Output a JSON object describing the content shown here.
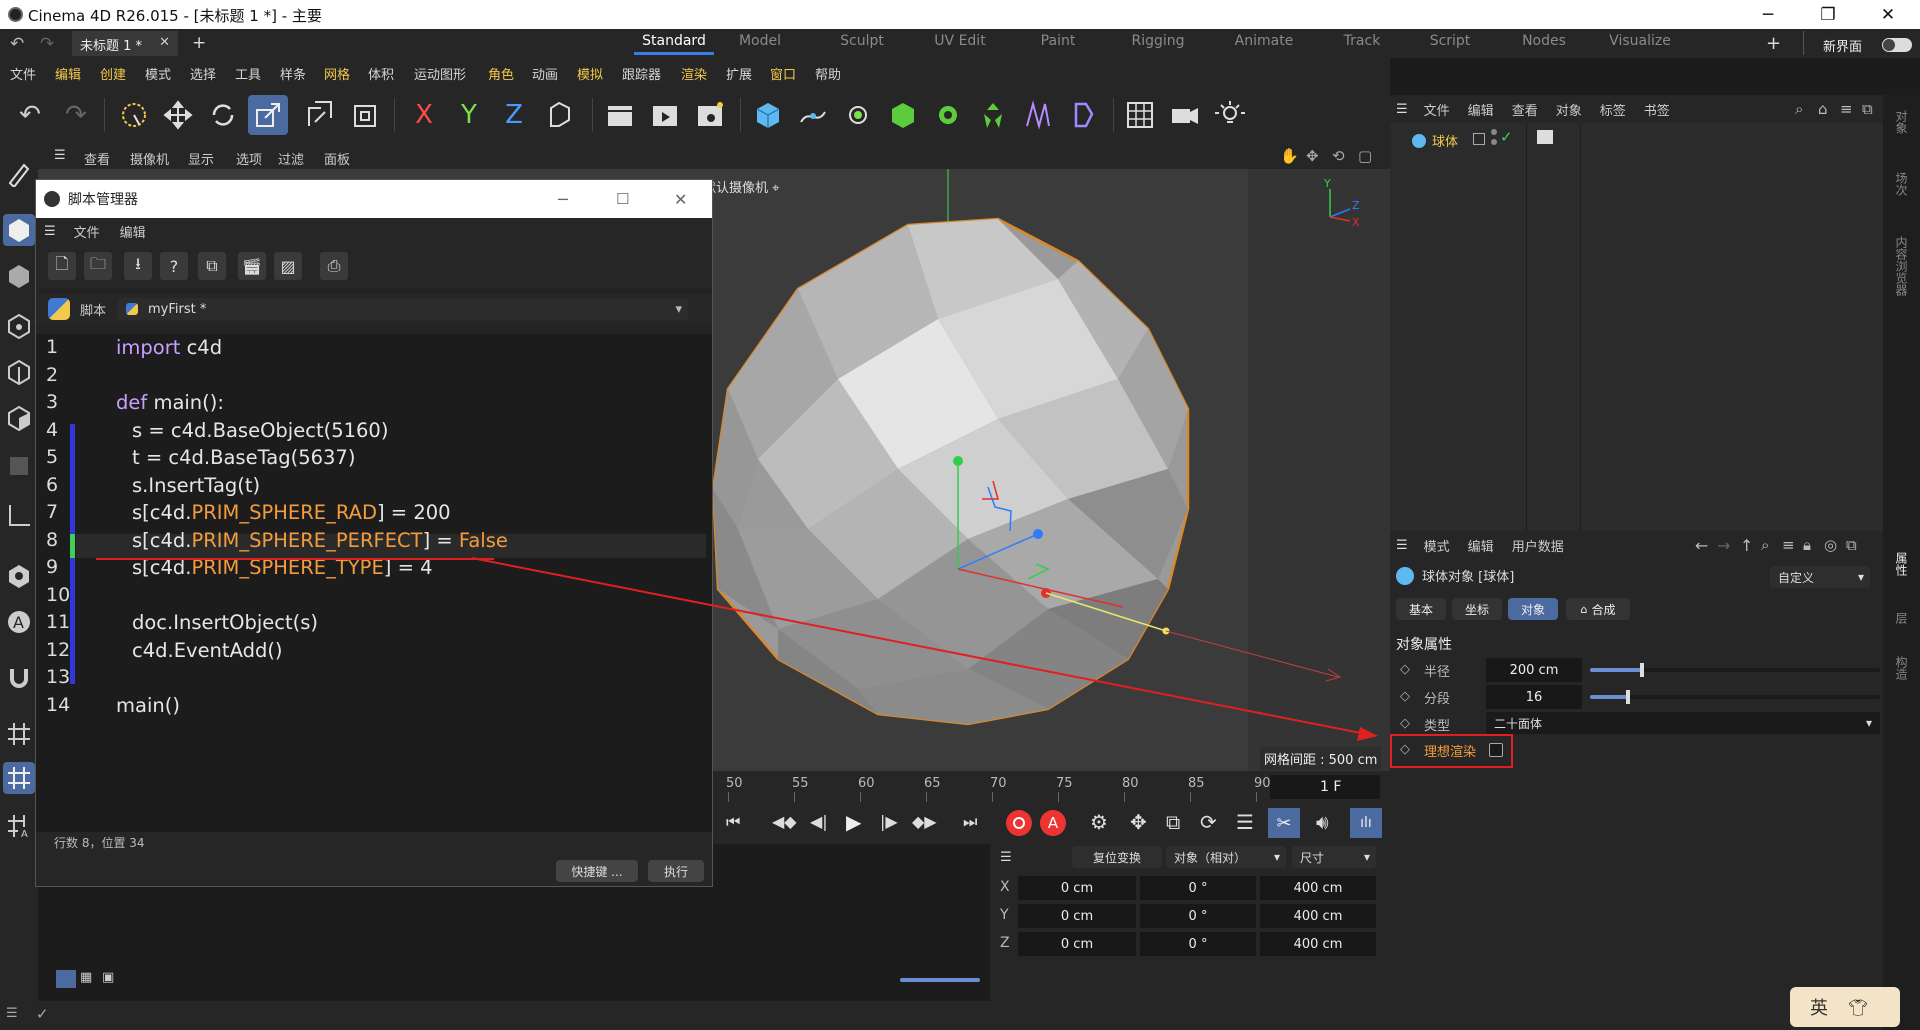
{
  "window": {
    "title": "Cinema 4D R26.015 - [未标题 1 *] - 主要"
  },
  "doc_tab": {
    "label": "未标题 1 *"
  },
  "layouts": [
    "Standard",
    "Model",
    "Sculpt",
    "UV Edit",
    "Paint",
    "Rigging",
    "Animate",
    "Track",
    "Script",
    "Nodes",
    "Visualize"
  ],
  "new_layout": "新界面",
  "menu": [
    "文件",
    "编辑",
    "创建",
    "模式",
    "选择",
    "工具",
    "样条",
    "网格",
    "体积",
    "运动图形",
    "角色",
    "动画",
    "模拟",
    "跟踪器",
    "渲染",
    "扩展",
    "窗口",
    "帮助"
  ],
  "viewport": {
    "menu": [
      "查看",
      "摄像机",
      "显示",
      "选项",
      "过滤",
      "面板"
    ],
    "camera": "默认摄像机",
    "grid_label": "网格间距 : 500 cm",
    "axis": {
      "y": "Y",
      "z": "Z",
      "x": "X"
    }
  },
  "script_manager": {
    "title": "脚本管理器",
    "menu": [
      "文件",
      "编辑"
    ],
    "script_label": "脚本",
    "script_name": "myFirst *",
    "lines": [
      {
        "n": "1",
        "text": "import c4d"
      },
      {
        "n": "2",
        "text": ""
      },
      {
        "n": "3",
        "text": "def main():"
      },
      {
        "n": "4",
        "text": "s = c4d.BaseObject(5160)"
      },
      {
        "n": "5",
        "text": "t = c4d.BaseTag(5637)"
      },
      {
        "n": "6",
        "text": "s.InsertTag(t)"
      },
      {
        "n": "7",
        "text": "s[c4d.PRIM_SPHERE_RAD] = 200"
      },
      {
        "n": "8",
        "text": "s[c4d.PRIM_SPHERE_PERFECT] = False"
      },
      {
        "n": "9",
        "text": "s[c4d.PRIM_SPHERE_TYPE] = 4"
      },
      {
        "n": "10",
        "text": ""
      },
      {
        "n": "11",
        "text": "doc.InsertObject(s)"
      },
      {
        "n": "12",
        "text": "c4d.EventAdd()"
      },
      {
        "n": "13",
        "text": ""
      },
      {
        "n": "14",
        "text": "main()"
      }
    ],
    "status": "行数 8，位置 34",
    "shortcut_button": "快捷键 ...",
    "run_button": "执行"
  },
  "timeline": {
    "ticks": [
      "50",
      "55",
      "60",
      "65",
      "70",
      "75",
      "80",
      "85",
      "90"
    ],
    "current_frame": "1 F"
  },
  "coords": {
    "reset_button": "复位变换",
    "mode_select": "对象（相对）",
    "size_select": "尺寸",
    "rows": [
      {
        "axis": "X",
        "pos": "0 cm",
        "rot": "0 °",
        "size": "400 cm"
      },
      {
        "axis": "Y",
        "pos": "0 cm",
        "rot": "0 °",
        "size": "400 cm"
      },
      {
        "axis": "Z",
        "pos": "0 cm",
        "rot": "0 °",
        "size": "400 cm"
      }
    ]
  },
  "object_manager": {
    "menu": [
      "文件",
      "编辑",
      "查看",
      "对象",
      "标签",
      "书签"
    ],
    "object_name": "球体"
  },
  "attributes": {
    "menu": [
      "模式",
      "编辑",
      "用户数据"
    ],
    "object_title": "球体对象 [球体]",
    "preset": "自定义",
    "tabs": [
      "基本",
      "坐标",
      "对象",
      "合成"
    ],
    "section": "对象属性",
    "radius_label": "半径",
    "radius_value": "200 cm",
    "radius_slider": 0.18,
    "segments_label": "分段",
    "segments_value": "16",
    "segments_slider": 0.13,
    "type_label": "类型",
    "type_value": "二十面体",
    "perfect_label": "理想渲染"
  },
  "side_tabs": [
    "对象",
    "场次",
    "内容浏览器",
    "属性",
    "层",
    "构造"
  ],
  "ime": {
    "label": "英"
  },
  "colors": {
    "accent": "#4b6aa0",
    "highlight_red": "#e02020",
    "attr_orange": "#f39c3d",
    "keyword_purple": "#c9a0ff"
  }
}
